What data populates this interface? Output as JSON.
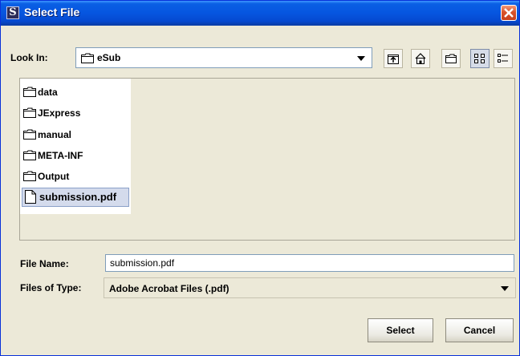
{
  "window": {
    "title": "Select File",
    "app_icon_letter": "S"
  },
  "look_in": {
    "label": "Look In:",
    "value": "eSub",
    "icon": "folder-icon"
  },
  "toolbar": {
    "buttons": [
      "up-one-level-icon",
      "home-icon",
      "new-folder-icon",
      "list-view-icon",
      "details-view-icon"
    ]
  },
  "files": {
    "items": [
      {
        "name": "data",
        "icon": "folder-icon"
      },
      {
        "name": "JExpress",
        "icon": "folder-icon"
      },
      {
        "name": "manual",
        "icon": "folder-icon"
      },
      {
        "name": "META-INF",
        "icon": "folder-icon"
      },
      {
        "name": "Output",
        "icon": "folder-icon"
      },
      {
        "name": "submission.pdf",
        "icon": "file-icon",
        "selected": true
      }
    ]
  },
  "file_name": {
    "label": "File Name:",
    "value": "submission.pdf"
  },
  "file_type": {
    "label": "Files of Type:",
    "value": "Adobe Acrobat Files (.pdf)"
  },
  "buttons": {
    "select": "Select",
    "cancel": "Cancel"
  },
  "colors": {
    "title_bar": "#0656e0",
    "close_button": "#d9532a",
    "dialog_bg": "#ece9d8",
    "selection": "#d4dbec"
  }
}
